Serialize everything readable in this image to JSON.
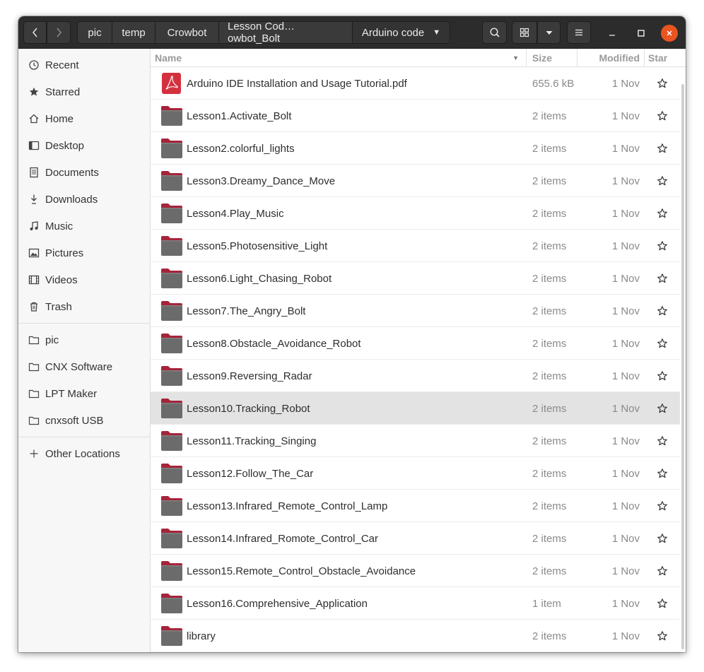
{
  "window": {
    "title": "Arduino code"
  },
  "toolbar": {
    "crumbs": [
      "pic",
      "temp",
      "Crowbot",
      "Lesson Cod…owbot_Bolt",
      "Arduino code"
    ],
    "icons": [
      "back-icon",
      "forward-icon",
      "search-icon",
      "grid-view-icon",
      "chevron-down-icon",
      "hamburger-menu-icon",
      "minimize-icon",
      "maximize-icon",
      "close-icon"
    ]
  },
  "sidebar": {
    "places": [
      {
        "label": "Recent",
        "icon": "clock-icon"
      },
      {
        "label": "Starred",
        "icon": "star-icon"
      },
      {
        "label": "Home",
        "icon": "home-icon"
      },
      {
        "label": "Desktop",
        "icon": "desktop-icon"
      },
      {
        "label": "Documents",
        "icon": "document-icon"
      },
      {
        "label": "Downloads",
        "icon": "download-icon"
      },
      {
        "label": "Music",
        "icon": "music-icon"
      },
      {
        "label": "Pictures",
        "icon": "pictures-icon"
      },
      {
        "label": "Videos",
        "icon": "video-icon"
      },
      {
        "label": "Trash",
        "icon": "trash-icon"
      }
    ],
    "bookmarks": [
      {
        "label": "pic",
        "icon": "folder-icon"
      },
      {
        "label": "CNX Software",
        "icon": "folder-icon"
      },
      {
        "label": "LPT Maker",
        "icon": "folder-icon"
      },
      {
        "label": "cnxsoft USB",
        "icon": "folder-icon"
      }
    ],
    "other": {
      "label": "Other Locations",
      "icon": "plus-icon"
    }
  },
  "columns": {
    "name": "Name",
    "size": "Size",
    "modified": "Modified",
    "star": "Star"
  },
  "files": [
    {
      "name": "Arduino IDE Installation and Usage Tutorial.pdf",
      "size": "655.6 kB",
      "modified": "1 Nov",
      "type": "pdf"
    },
    {
      "name": "Lesson1.Activate_Bolt",
      "size": "2 items",
      "modified": "1 Nov",
      "type": "folder"
    },
    {
      "name": "Lesson2.colorful_lights",
      "size": "2 items",
      "modified": "1 Nov",
      "type": "folder"
    },
    {
      "name": "Lesson3.Dreamy_Dance_Move",
      "size": "2 items",
      "modified": "1 Nov",
      "type": "folder"
    },
    {
      "name": "Lesson4.Play_Music",
      "size": "2 items",
      "modified": "1 Nov",
      "type": "folder"
    },
    {
      "name": "Lesson5.Photosensitive_Light",
      "size": "2 items",
      "modified": "1 Nov",
      "type": "folder"
    },
    {
      "name": "Lesson6.Light_Chasing_Robot",
      "size": "2 items",
      "modified": "1 Nov",
      "type": "folder"
    },
    {
      "name": "Lesson7.The_Angry_Bolt",
      "size": "2 items",
      "modified": "1 Nov",
      "type": "folder"
    },
    {
      "name": "Lesson8.Obstacle_Avoidance_Robot",
      "size": "2 items",
      "modified": "1 Nov",
      "type": "folder"
    },
    {
      "name": "Lesson9.Reversing_Radar",
      "size": "2 items",
      "modified": "1 Nov",
      "type": "folder"
    },
    {
      "name": "Lesson10.Tracking_Robot",
      "size": "2 items",
      "modified": "1 Nov",
      "type": "folder",
      "selected": true
    },
    {
      "name": "Lesson11.Tracking_Singing",
      "size": "2 items",
      "modified": "1 Nov",
      "type": "folder"
    },
    {
      "name": "Lesson12.Follow_The_Car",
      "size": "2 items",
      "modified": "1 Nov",
      "type": "folder"
    },
    {
      "name": "Lesson13.Infrared_Remote_Control_Lamp",
      "size": "2 items",
      "modified": "1 Nov",
      "type": "folder"
    },
    {
      "name": "Lesson14.Infrared_Romote_Control_Car",
      "size": "2 items",
      "modified": "1 Nov",
      "type": "folder"
    },
    {
      "name": "Lesson15.Remote_Control_Obstacle_Avoidance",
      "size": "2 items",
      "modified": "1 Nov",
      "type": "folder"
    },
    {
      "name": "Lesson16.Comprehensive_Application",
      "size": "1 item",
      "modified": "1 Nov",
      "type": "folder"
    },
    {
      "name": "library",
      "size": "2 items",
      "modified": "1 Nov",
      "type": "folder"
    }
  ],
  "colors": {
    "headerbar": "#2c2c2c",
    "close": "#e9541f",
    "folder": "#6b6b6b",
    "folder_tab": "#a6243a",
    "pdf": "#d4313f",
    "selection": "#e3e3e3"
  }
}
